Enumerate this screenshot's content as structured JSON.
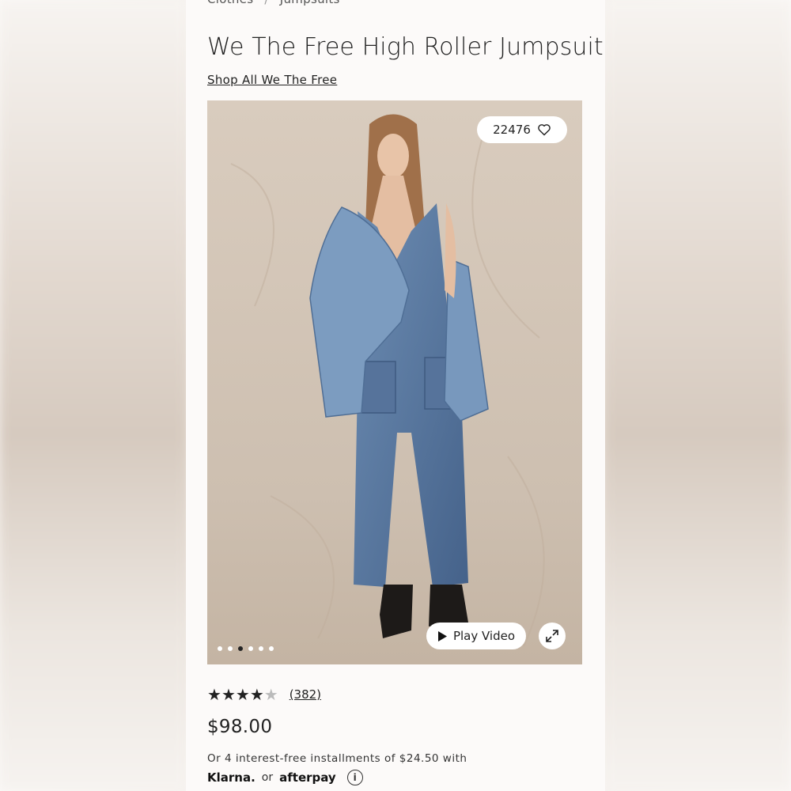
{
  "breadcrumb": {
    "items": [
      "Clothes",
      "Jumpsuits"
    ],
    "separator": "/"
  },
  "product": {
    "title": "We The Free High Roller Jumpsuit",
    "shop_link": "Shop All We The Free",
    "favorites_count": "22476",
    "play_video_label": "Play Video",
    "image_count": 6,
    "active_image_index": 2,
    "rating": 4,
    "rating_max": 5,
    "review_count": "(382)",
    "price": "$98.00",
    "installments_text": "Or 4 interest-free installments of $24.50 with",
    "pay_klarna": "Klarna.",
    "pay_or": "or",
    "pay_afterpay": "afterpay",
    "info_glyph": "i"
  },
  "icons": [
    "heart-icon",
    "play-icon",
    "expand-icon",
    "info-icon"
  ],
  "colors": {
    "text": "#222222",
    "panel_bg": "#fcfaf9",
    "denim": "#5f7fa6"
  }
}
